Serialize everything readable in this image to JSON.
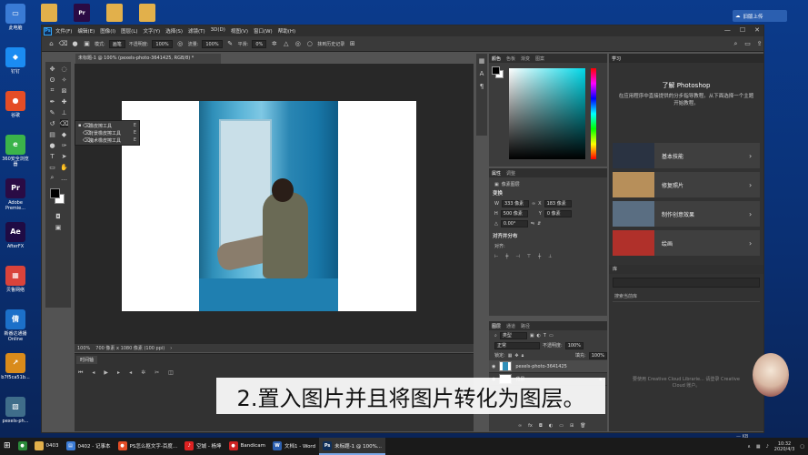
{
  "desktop": {
    "left_icons": [
      {
        "label": "此电脑",
        "color": "#3a7bd5",
        "glyph": "▭"
      },
      {
        "label": "钉钉",
        "color": "#1b8cf2",
        "glyph": "◆"
      },
      {
        "label": "谷歌",
        "color": "#e44d26",
        "glyph": "●"
      },
      {
        "label": "360安全浏览器",
        "color": "#3bb44a",
        "glyph": "e"
      },
      {
        "label": "Adobe Premie...",
        "color": "#2a0b44",
        "glyph": "Pr"
      },
      {
        "label": "AfterFX",
        "color": "#1f0b44",
        "glyph": "Ae"
      },
      {
        "label": "贝鲁网络",
        "color": "#d9433b",
        "glyph": "▦"
      },
      {
        "label": "新番达通播 Online",
        "color": "#1c70c9",
        "glyph": "倩"
      },
      {
        "label": "b7f5ca51b...",
        "color": "#d98b1b",
        "glyph": "↗"
      },
      {
        "label": "pexels-ph...",
        "color": "#3f6d8a",
        "glyph": "▧"
      }
    ],
    "top_icons": [
      {
        "color": "#e2b04b",
        "glyph": ""
      },
      {
        "color": "#2a0b44",
        "glyph": "Pr"
      },
      {
        "color": "#e2b04b",
        "glyph": ""
      },
      {
        "color": "#e2b04b",
        "glyph": ""
      }
    ],
    "login_label": "旧版上传"
  },
  "ps": {
    "menu": [
      "文件(F)",
      "编辑(E)",
      "图像(I)",
      "图层(L)",
      "文字(Y)",
      "选择(S)",
      "滤镜(T)",
      "3D(D)",
      "视图(V)",
      "窗口(W)",
      "帮助(H)"
    ],
    "win_controls": [
      "—",
      "☐",
      "✕"
    ],
    "options": {
      "mode_label": "模式:",
      "mode_value": "画笔",
      "opacity_label": "不透明度:",
      "opacity_value": "100%",
      "flow_label": "流量:",
      "flow_value": "100%",
      "smooth_label": "平滑:",
      "smooth_value": "0%",
      "erase_history": "抹到历史记录"
    },
    "doc_tab": "未标题-1 @ 100% (pexels-photo-3641425, RGB/8) *",
    "flyout": [
      {
        "name": "橡皮擦工具",
        "key": "E",
        "active": true
      },
      {
        "name": "背景橡皮擦工具",
        "key": "E",
        "active": false
      },
      {
        "name": "魔术橡皮擦工具",
        "key": "E",
        "active": false
      }
    ],
    "status": {
      "zoom": "100%",
      "size": "700 像素 x 1080 像素 (100 ppi)"
    },
    "timeline_tab": "时间轴",
    "color_tabs": [
      "颜色",
      "色板",
      "渐变",
      "图案"
    ],
    "properties": {
      "tabs": [
        "属性",
        "调整"
      ],
      "kind": "像素图层",
      "transform": "变换",
      "w": "333 像素",
      "h": "183 像素",
      "w2": "500 像素",
      "h2": "0 像素",
      "angle": "0.00°",
      "align": "对齐并分布",
      "align_sub": "对齐:"
    },
    "layers": {
      "tabs": [
        "图层",
        "通道",
        "路径"
      ],
      "filter": "类型",
      "blend": "正常",
      "opacity_label": "不透明度:",
      "opacity": "100%",
      "lock_label": "锁定:",
      "fill_label": "填充:",
      "fill": "100%",
      "rows": [
        {
          "name": "pexels-photo-3641425",
          "selected": true
        },
        {
          "name": "背景",
          "selected": false
        }
      ]
    },
    "learn": {
      "tab": "学习",
      "title": "了解 Photoshop",
      "desc": "在应用程序中直接提供的分步指导教程。从下面选择一个主题开始教程。",
      "cards": [
        {
          "label": "基本技能",
          "color": "#2a3342"
        },
        {
          "label": "修复照片",
          "color": "#b78f5a"
        },
        {
          "label": "制作创意效果",
          "color": "#5a6e82"
        },
        {
          "label": "绘画",
          "color": "#b0302a"
        }
      ]
    },
    "library": {
      "tab": "库",
      "search": "搜索当前库",
      "empty": "要使用 Creative Cloud Librarie... 请登录 Creative Cloud 账户。",
      "kb": "— KB"
    }
  },
  "caption": "2.置入图片并且将图片转化为图层。",
  "taskbar": {
    "items": [
      {
        "label": "0403",
        "color": "#e2b04b",
        "glyph": "",
        "active": false
      },
      {
        "label": "0402 - 记事本",
        "color": "#3a7bd5",
        "glyph": "▤",
        "active": false
      },
      {
        "label": "PS怎么抠文字-百度...",
        "color": "#e44d26",
        "glyph": "●",
        "active": false
      },
      {
        "label": "空城 - 杨坤",
        "color": "#d22",
        "glyph": "♪",
        "active": false
      },
      {
        "label": "Bandicam",
        "color": "#c22",
        "glyph": "●",
        "active": false
      },
      {
        "label": "文档1 - Word",
        "color": "#2b5fb0",
        "glyph": "W",
        "active": false
      },
      {
        "label": "未标题-1 @ 100%...",
        "color": "#0f2f5a",
        "glyph": "Ps",
        "active": true
      }
    ],
    "time": "10:32",
    "date": "2020/4/3"
  }
}
